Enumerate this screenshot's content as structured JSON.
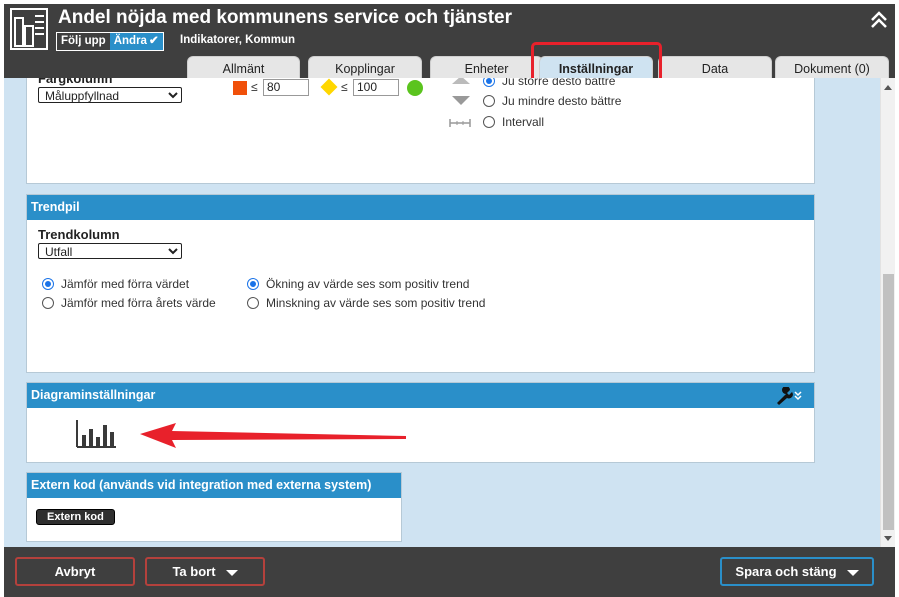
{
  "header": {
    "title": "Andel nöjda med kommunens service och tjänster",
    "mode_follow": "Följ upp",
    "mode_edit": "Ändra",
    "breadcrumb": "Indikatorer, Kommun"
  },
  "tabs": [
    "Allmänt",
    "Kopplingar",
    "Enheter",
    "Inställningar",
    "Data",
    "Dokument (0)"
  ],
  "active_tab": "Inställningar",
  "color_section": {
    "column_label": "Färgkolumn",
    "column_value": "Måluppfyllnad",
    "lte": "≤",
    "threshold_1": "80",
    "threshold_2": "100",
    "colors": {
      "red": "#f0500a",
      "yellow": "#ffd700",
      "green": "#5bc41e"
    },
    "direction_options": [
      "Ju större desto bättre",
      "Ju mindre desto bättre",
      "Intervall"
    ]
  },
  "trend": {
    "heading": "Trendpil",
    "column_label": "Trendkolumn",
    "column_value": "Utfall",
    "compare_options": [
      "Jämför med förra värdet",
      "Jämför med förra årets värde"
    ],
    "trend_options": [
      "Ökning av värde ses som positiv trend",
      "Minskning av värde ses som positiv trend"
    ]
  },
  "diagram": {
    "heading": "Diagraminställningar"
  },
  "external": {
    "heading": "Extern kod (används vid integration med externa system)",
    "button": "Extern kod"
  },
  "footer": {
    "cancel": "Avbryt",
    "delete": "Ta bort",
    "save": "Spara och stäng"
  },
  "colors": {
    "header_bg": "#3f3f3f",
    "accent": "#2a8fc9",
    "content_bg": "#cfe3f2",
    "annotation": "#e8212b"
  }
}
